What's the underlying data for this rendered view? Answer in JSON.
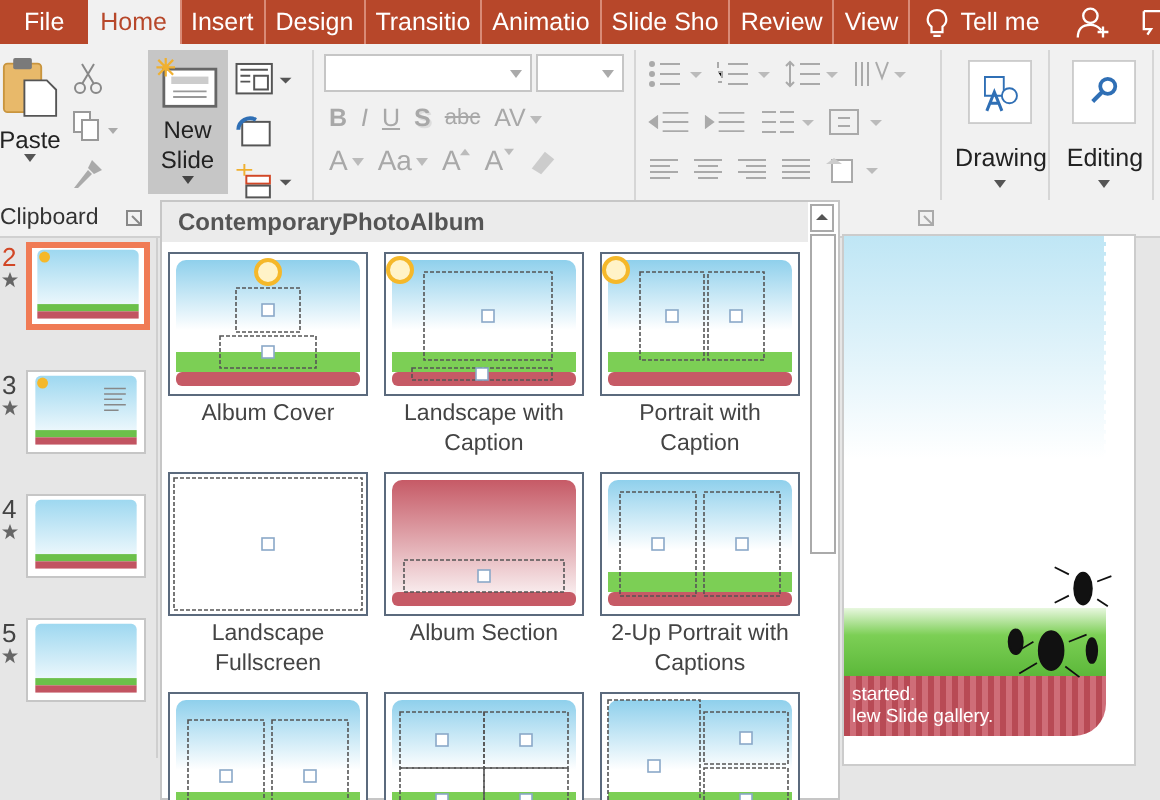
{
  "tabs": [
    {
      "label": "File",
      "selected": false
    },
    {
      "label": "Home",
      "selected": true
    },
    {
      "label": "Insert",
      "selected": false
    },
    {
      "label": "Design",
      "selected": false
    },
    {
      "label": "Transitio",
      "selected": false
    },
    {
      "label": "Animatio",
      "selected": false
    },
    {
      "label": "Slide Sho",
      "selected": false
    },
    {
      "label": "Review",
      "selected": false
    },
    {
      "label": "View",
      "selected": false
    }
  ],
  "tell_me": "Tell me",
  "ribbon": {
    "paste": "Paste",
    "new_slide": {
      "label": "New Slide",
      "pressed": true
    },
    "clipboard_label": "Clipboard",
    "font_disabled": true,
    "font_row_1": [
      {
        "label": "B",
        "kind": "bold"
      },
      {
        "label": "I",
        "kind": "italic"
      },
      {
        "label": "U",
        "kind": "underline"
      },
      {
        "label": "S",
        "kind": "shadow"
      },
      {
        "label": "abc",
        "kind": "strike"
      },
      {
        "label": "AV",
        "kind": "dropdown"
      }
    ],
    "font_row_2": [
      {
        "label": "A",
        "kind": "dropdown"
      },
      {
        "label": "Aa",
        "kind": "dropdown"
      },
      {
        "label": "A",
        "kind": "grow"
      },
      {
        "label": "A",
        "kind": "shrink"
      }
    ],
    "big_groups": [
      "Drawing",
      "Editing"
    ]
  },
  "slides": [
    {
      "number": "2",
      "selected": true,
      "kind": "photo"
    },
    {
      "number": "3",
      "selected": false,
      "kind": "text"
    },
    {
      "number": "4",
      "selected": false,
      "kind": "photo"
    },
    {
      "number": "5",
      "selected": false,
      "kind": "photo"
    }
  ],
  "gallery": {
    "title": "ContemporaryPhotoAlbum",
    "layouts": [
      {
        "label": "Album Cover",
        "kind": "cover"
      },
      {
        "label": "Landscape with Caption",
        "kind": "landscape"
      },
      {
        "label": "Portrait with Caption",
        "kind": "portrait"
      },
      {
        "label": "Landscape Fullscreen",
        "kind": "fullscreen"
      },
      {
        "label": "Album Section",
        "kind": "section"
      },
      {
        "label": "2-Up Portrait with Captions",
        "kind": "twoup"
      },
      {
        "kind": "twoland"
      },
      {
        "kind": "fourup"
      },
      {
        "kind": "mixed"
      }
    ]
  },
  "slide_text": [
    "started.",
    "lew Slide gallery."
  ]
}
